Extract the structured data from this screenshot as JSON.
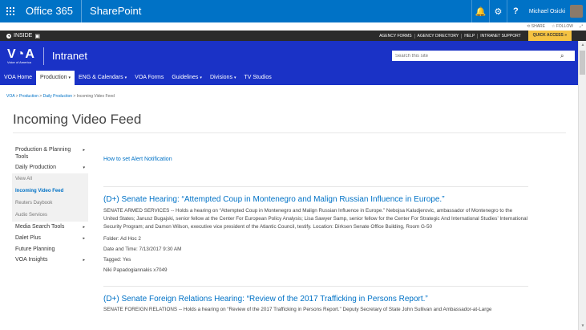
{
  "suite": {
    "brand": "Office 365",
    "app": "SharePoint",
    "user": "Michael Osicki",
    "bell": "🔔",
    "gear": "⚙",
    "help": "?"
  },
  "sharebar": {
    "share": "SHARE",
    "follow": "FOLLOW"
  },
  "inside": {
    "brand": "INSIDE",
    "links": [
      "AGENCY FORMS",
      "AGENCY DIRECTORY",
      "HELP",
      "INTRANET SUPPORT"
    ],
    "quick_access": "QUICK ACCESS »"
  },
  "header": {
    "logo": "V◔A",
    "logo_sub": "Voice of America",
    "site_title": "Intranet",
    "search_placeholder": "Search this site"
  },
  "nav": {
    "items": [
      {
        "label": "VOA Home",
        "caret": ""
      },
      {
        "label": "Production",
        "caret": "▾"
      },
      {
        "label": "ENG & Calendars",
        "caret": "▾"
      },
      {
        "label": "VOA Forms",
        "caret": ""
      },
      {
        "label": "Guidelines",
        "caret": "▾"
      },
      {
        "label": "Divisions",
        "caret": "▾"
      },
      {
        "label": "TV Studios",
        "caret": ""
      }
    ]
  },
  "breadcrumb": {
    "items": [
      "VOA",
      "Production",
      "Daily Production"
    ],
    "sep": ">",
    "current": "Incoming Video Feed"
  },
  "page_title": "Incoming Video Feed",
  "leftnav": {
    "items": [
      {
        "label": "Production & Planning Tools",
        "arrow": "▸"
      },
      {
        "label": "Daily Production",
        "arrow": "▾"
      }
    ],
    "sub": [
      "View All",
      "Incoming Video Feed",
      "Reuters Daybook",
      "Audio Services"
    ],
    "items_after": [
      {
        "label": "Media Search Tools",
        "arrow": "▸"
      },
      {
        "label": "Dalet Plus",
        "arrow": "▸"
      },
      {
        "label": "Future Planning",
        "arrow": ""
      },
      {
        "label": "VOA Insights",
        "arrow": "▸"
      }
    ]
  },
  "main": {
    "alert_link": "How to set Alert Notification",
    "events": [
      {
        "title": "(D+) Senate Hearing: “Attempted Coup in Montenegro and Malign Russian Influence in Europe.”",
        "desc": "SENATE ARMED SERVICES -- Holds a hearing on “Attempted Coup in Montenegro and Malign Russian Influence in Europe.” Nebojsa Kaludjerovic, ambassador of Montenegro to the United States; Janusz Bugajski, senior fellow at the Center For European Policy Analysis; Lisa Sawyer Samp, senior fellow for the Center For Strategic And International Studies’ International Security Program; and Damon Wilson, executive vice president of the Atlantic Council, testify. Location: Dirksen Senate Office Building, Room G-50",
        "folder": "Folder: Ad Hoc 2",
        "datetime": "Date and Time: 7/13/2017 9:30 AM",
        "tagged": "Tagged: Yes",
        "contact": "Niki Papadogiannakis x7049"
      },
      {
        "title": "(D+) Senate Foreign Relations Hearing: “Review of the 2017 Trafficking in Persons Report.”",
        "desc": "SENATE FOREIGN RELATIONS -- Holds a hearing on “Review of the 2017 Trafficking in Persons Report.” Deputy Secretary of State John Sullivan and Ambassador-at-Large"
      }
    ]
  }
}
